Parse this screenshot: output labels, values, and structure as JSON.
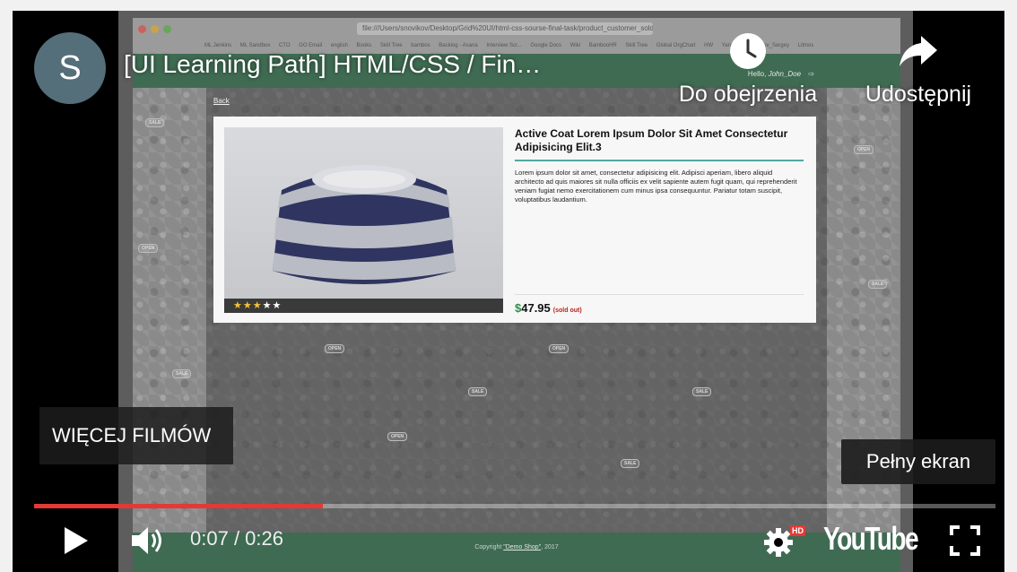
{
  "player": {
    "channel_initial": "S",
    "video_title": "[UI Learning Path] HTML/CSS / Fin…",
    "watch_later_label": "Do obejrzenia",
    "share_label": "Udostępnij",
    "more_videos_label": "WIĘCEJ FILMÓW",
    "fullscreen_tooltip": "Pełny ekran",
    "time_current": "0:07",
    "time_total": "0:26",
    "time_separator": " / ",
    "progress_fraction": 0.3,
    "youtube_logo": "YouTube",
    "hd_badge": "HD",
    "colors": {
      "progress": "#e53935",
      "avatar": "#546e7a"
    }
  },
  "video_frame": {
    "browser": {
      "address": "file:///Users/snovikov/Desktop/Grid%20UI/html-css-sourse-final-task/product_customer_sold...",
      "bookmarks": [
        "ML Jenkins",
        "ML Sandbox",
        "CTO",
        "GO Email",
        "english",
        "Books",
        "Skill Tree",
        "bambos",
        "Backlog - Asana",
        "Interview Scr...",
        "Google Docs",
        "Wiki",
        "BambooHR",
        "Skill Tree",
        "Global OrgChart",
        "HW",
        "Yandex",
        "snovikov_Sergey",
        "Litmos"
      ]
    },
    "site": {
      "greeting": "Hello,",
      "username": "John_Doe",
      "back_link": "Back",
      "product": {
        "title": "Active Coat Lorem Ipsum Dolor Sit Amet Consectetur Adipisicing Elit.3",
        "description": "Lorem ipsum dolor sit amet, consectetur adipisicing elit. Adipisci aperiam, libero aliquid architecto ad quis maiores sit nulla officiis ex velit sapiente autem fugit quam, qui reprehenderit veniam fugiat nemo exercitationem cum minus ipsa consequuntur. Pariatur totam suscipit, voluptatibus laudantium.",
        "currency": "$",
        "price": "47.95",
        "status": "(sold out)",
        "rating": 3,
        "rating_max": 5
      },
      "footer": {
        "prefix": "Copyright ",
        "shop": "\"Demo Shop\"",
        "year": ", 2017"
      },
      "pattern_tags": [
        "OPEN",
        "SALE"
      ]
    }
  }
}
